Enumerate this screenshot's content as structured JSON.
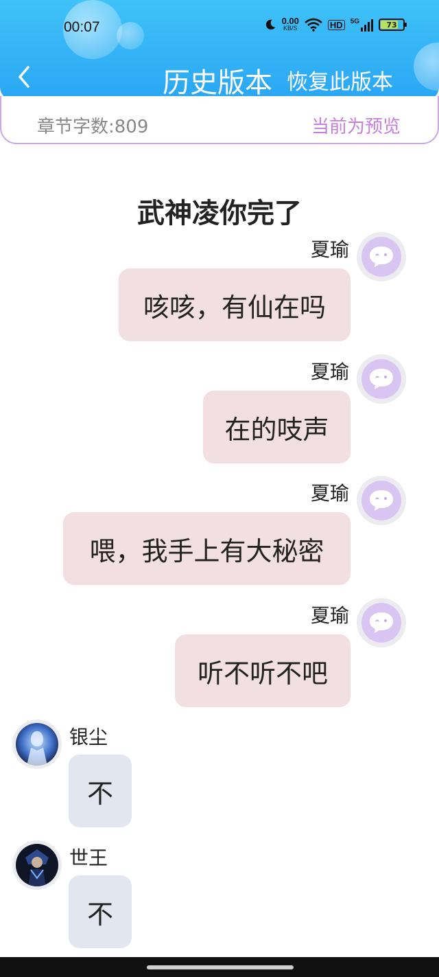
{
  "status_bar": {
    "time": "00:07",
    "net_speed_value": "0.00",
    "net_speed_unit": "KB/S",
    "hd": "HD",
    "network": "5G",
    "battery": "73",
    "battery_level": 0.73
  },
  "header": {
    "title": "历史版本",
    "restore_label": "恢复此版本",
    "back_icon": "chevron-left-icon"
  },
  "subbar": {
    "word_count": "章节字数:809",
    "preview_label": "当前为预览"
  },
  "chapter_title": "武神凌你完了",
  "messages": [
    {
      "sender": "夏瑜",
      "side": "right",
      "text": "咳咳，有仙在吗"
    },
    {
      "sender": "夏瑜",
      "side": "right",
      "text": "在的吱声"
    },
    {
      "sender": "夏瑜",
      "side": "right",
      "text": "喂，我手上有大秘密"
    },
    {
      "sender": "夏瑜",
      "side": "right",
      "text": "听不听不吧"
    },
    {
      "sender": "银尘",
      "side": "left",
      "text": "不"
    },
    {
      "sender": "世王",
      "side": "left",
      "text": "不"
    }
  ],
  "colors": {
    "header": "#2aa6f4",
    "accent_purple": "#c77ee0",
    "right_bubble": "#f2dfe1",
    "left_bubble": "#e2e6ee"
  }
}
